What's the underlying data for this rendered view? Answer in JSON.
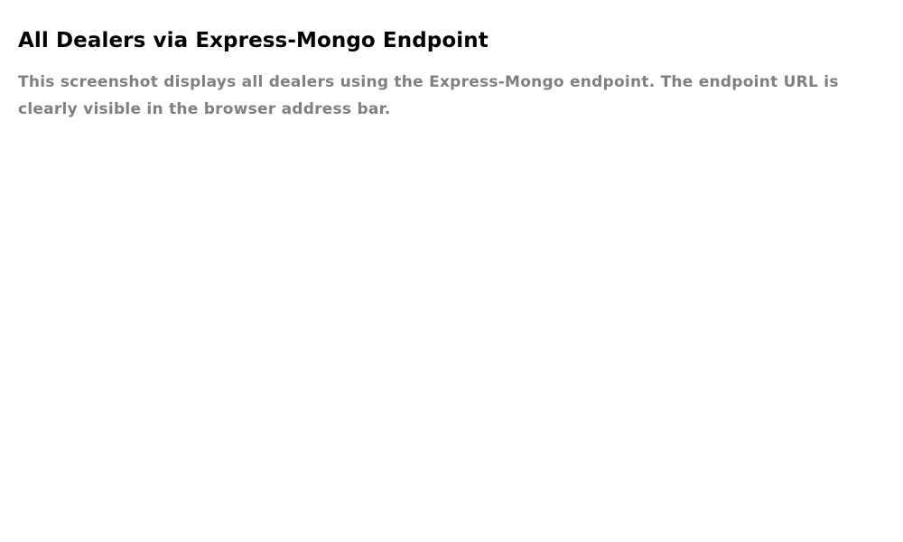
{
  "heading": {
    "title": "All Dealers via Express-Mongo Endpoint"
  },
  "body": {
    "description": "This screenshot displays all dealers using the Express-Mongo endpoint. The endpoint URL is clearly visible in the browser address bar."
  },
  "colors": {
    "title": "#000000",
    "description": "#808080",
    "background": "#ffffff"
  }
}
